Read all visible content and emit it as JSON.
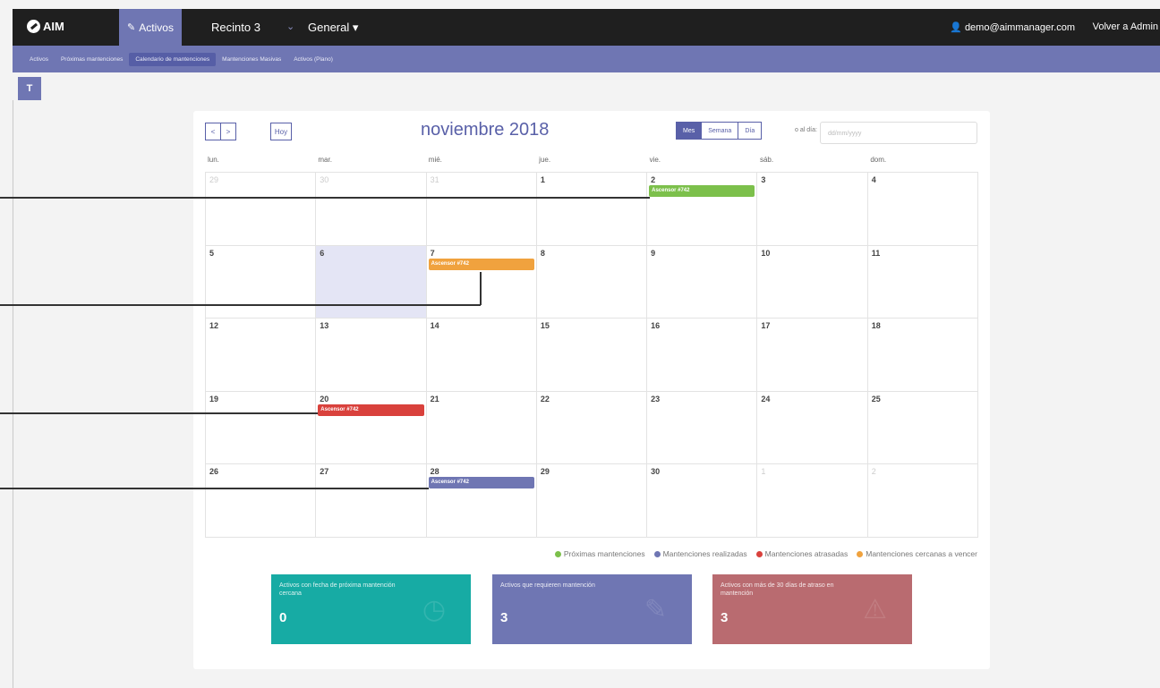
{
  "topbar": {
    "logo": "AIM",
    "activos_tab": "Activos",
    "recinto": "Recinto 3",
    "general": "General",
    "user_email": "demo@aimmanager.com",
    "back": "Volver a Admin"
  },
  "subnav": {
    "items": [
      {
        "label": "Activos"
      },
      {
        "label": "Próximas mantenciones"
      },
      {
        "label": "Calendario de mantenciones"
      },
      {
        "label": "Mantenciones Masivas"
      },
      {
        "label": "Activos (Plano)"
      }
    ]
  },
  "filter_icon": "T",
  "calendar": {
    "prev": "<",
    "next": ">",
    "today_btn": "Hoy",
    "title": "noviembre 2018",
    "views": {
      "month": "Mes",
      "week": "Semana",
      "day": "Día"
    },
    "goto_label": "o al día:",
    "goto_placeholder": "dd/mm/yyyy",
    "dow": [
      "lun.",
      "mar.",
      "mié.",
      "jue.",
      "vie.",
      "sáb.",
      "dom."
    ],
    "weeks": [
      [
        "29",
        "30",
        "31",
        "1",
        "2",
        "3",
        "4"
      ],
      [
        "5",
        "6",
        "7",
        "8",
        "9",
        "10",
        "11"
      ],
      [
        "12",
        "13",
        "14",
        "15",
        "16",
        "17",
        "18"
      ],
      [
        "19",
        "20",
        "21",
        "22",
        "23",
        "24",
        "25"
      ],
      [
        "26",
        "27",
        "28",
        "29",
        "30",
        "1",
        "2"
      ]
    ],
    "events": {
      "e1": "Ascensor #742",
      "e2": "Ascensor #742",
      "e3": "Ascensor #742",
      "e4": "Ascensor #742"
    }
  },
  "legend": {
    "upcoming": "Próximas mantenciones",
    "done": "Mantenciones realizadas",
    "late": "Mantenciones atrasadas",
    "soon": "Mantenciones cercanas a vencer"
  },
  "stats": {
    "s1": {
      "label": "Activos con fecha de próxima mantención cercana",
      "value": "0"
    },
    "s2": {
      "label": "Activos que requieren mantención",
      "value": "3"
    },
    "s3": {
      "label": "Activos con más de 30 días de atraso en mantención",
      "value": "3"
    }
  },
  "colors": {
    "upcoming": "#7cc04b",
    "done": "#6f76b3",
    "late": "#d9413c",
    "soon": "#f0a23e",
    "stat1": "#17aba4",
    "stat2": "#6f76b3",
    "stat3": "#b96b70"
  }
}
